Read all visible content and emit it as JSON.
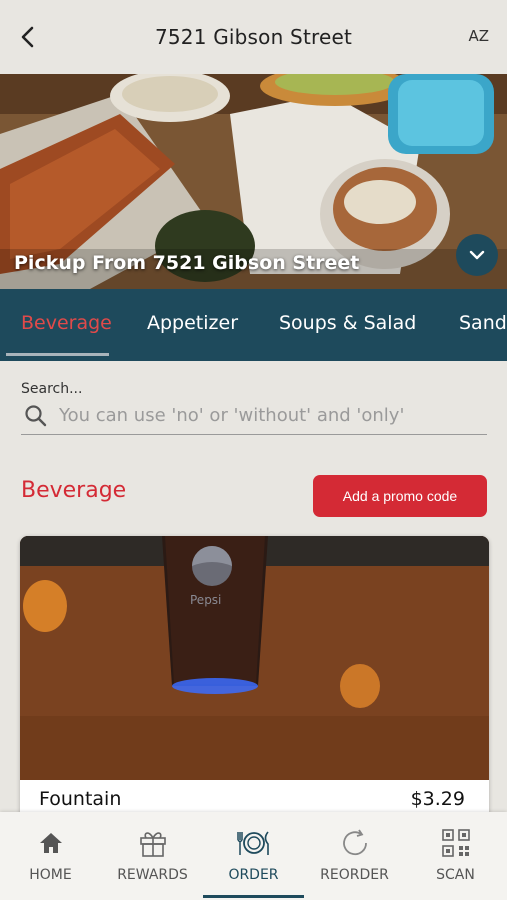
{
  "header": {
    "title": "7521 Gibson Street",
    "lang": "AZ"
  },
  "hero": {
    "caption": "Pickup From 7521 Gibson Street"
  },
  "tabs": [
    {
      "label": "Beverage"
    },
    {
      "label": "Appetizer"
    },
    {
      "label": "Soups & Salad"
    },
    {
      "label": "Sand"
    }
  ],
  "search": {
    "label": "Search...",
    "placeholder": "You can use 'no' or 'without' and 'only'"
  },
  "section": {
    "title": "Beverage",
    "promo_label": "Add a promo code"
  },
  "product": {
    "name": "Fountain",
    "price": "$3.29",
    "cup_brand": "Pepsi"
  },
  "nav": [
    {
      "label": "HOME",
      "icon": "home-icon"
    },
    {
      "label": "REWARDS",
      "icon": "gift-icon"
    },
    {
      "label": "ORDER",
      "icon": "plate-cutlery-icon"
    },
    {
      "label": "REORDER",
      "icon": "refresh-icon"
    },
    {
      "label": "SCAN",
      "icon": "qr-code-icon"
    }
  ],
  "colors": {
    "accent": "#d42a35",
    "primary": "#1e4a5c",
    "background": "#e8e6e1"
  }
}
